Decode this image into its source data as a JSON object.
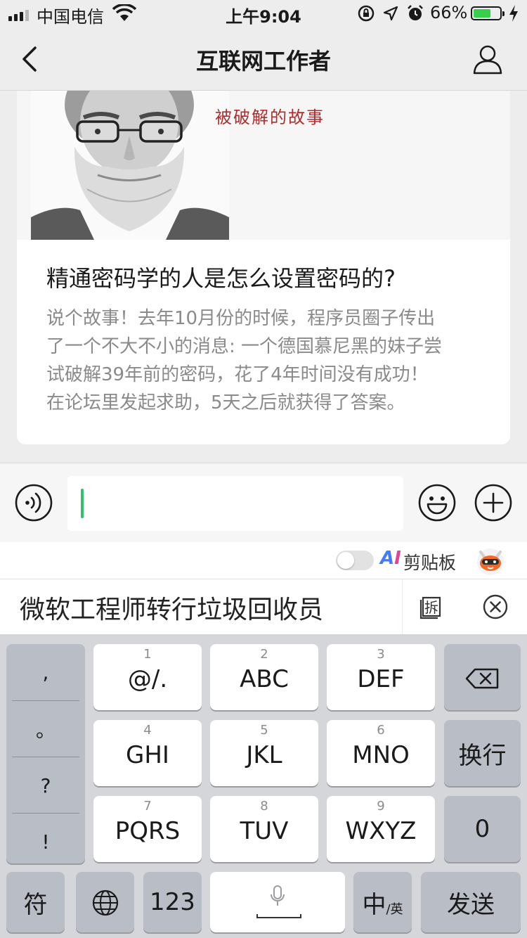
{
  "status_bar": {
    "carrier": "中国电信",
    "time": "上午9:04",
    "battery_percent": "66%",
    "battery_level": 0.66
  },
  "nav": {
    "title": "互联网工作者"
  },
  "article": {
    "image_overlay_text": "被破解的故事",
    "headline": "精通密码学的人是怎么设置密码的?",
    "summary_lines": [
      "说个故事！去年10月份的时候，程序员圈子传出",
      "了一个不大不小的消息: 一个德国慕尼黑的妹子尝",
      "试破解39年前的密码，花了4年时间没有成功！",
      "在论坛里发起求助，5天之后就获得了答案。"
    ]
  },
  "keyboard_toolbar": {
    "ai_a": "A",
    "ai_i": "I",
    "clipboard_label": "剪贴板"
  },
  "candidate": {
    "text": "微软工程师转行垃圾回收员",
    "split_glyph": "拆"
  },
  "keyboard": {
    "punctuation": [
      ",",
      "。",
      "?",
      "!"
    ],
    "keys": [
      {
        "num": "1",
        "label": "@/."
      },
      {
        "num": "2",
        "label": "ABC"
      },
      {
        "num": "3",
        "label": "DEF"
      },
      {
        "num": "4",
        "label": "GHI"
      },
      {
        "num": "5",
        "label": "JKL"
      },
      {
        "num": "6",
        "label": "MNO"
      },
      {
        "num": "7",
        "label": "PQRS"
      },
      {
        "num": "8",
        "label": "TUV"
      },
      {
        "num": "9",
        "label": "WXYZ"
      }
    ],
    "newline_label": "换行",
    "zero_label": "0",
    "symbol_label": "符",
    "num_label": "123",
    "lang_main": "中",
    "lang_sub": "/英",
    "send_label": "发送"
  },
  "colors": {
    "accent_green": "#2cc36b",
    "battery_green": "#36d04a",
    "overlay_red": "#b42a2a"
  }
}
